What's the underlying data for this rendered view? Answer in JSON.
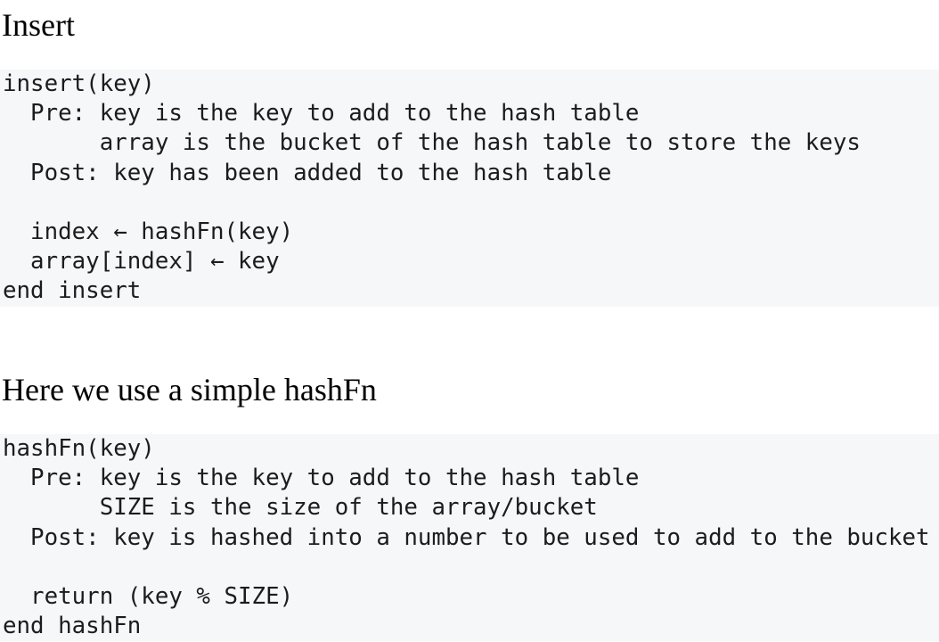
{
  "sections": [
    {
      "heading": "Insert",
      "code_lines": [
        "insert(key)",
        "  Pre: key is the key to add to the hash table",
        "       array is the bucket of the hash table to store the keys",
        "  Post: key has been added to the hash table",
        "",
        "  index ← hashFn(key)",
        "  array[index] ← key",
        "end insert"
      ]
    },
    {
      "heading": "Here we use a simple hashFn",
      "code_lines": [
        "hashFn(key)",
        "  Pre: key is the key to add to the hash table",
        "       SIZE is the size of the array/bucket",
        "  Post: key is hashed into a number to be used to add to the bucket",
        "",
        "  return (key % SIZE)",
        "end hashFn"
      ]
    }
  ]
}
